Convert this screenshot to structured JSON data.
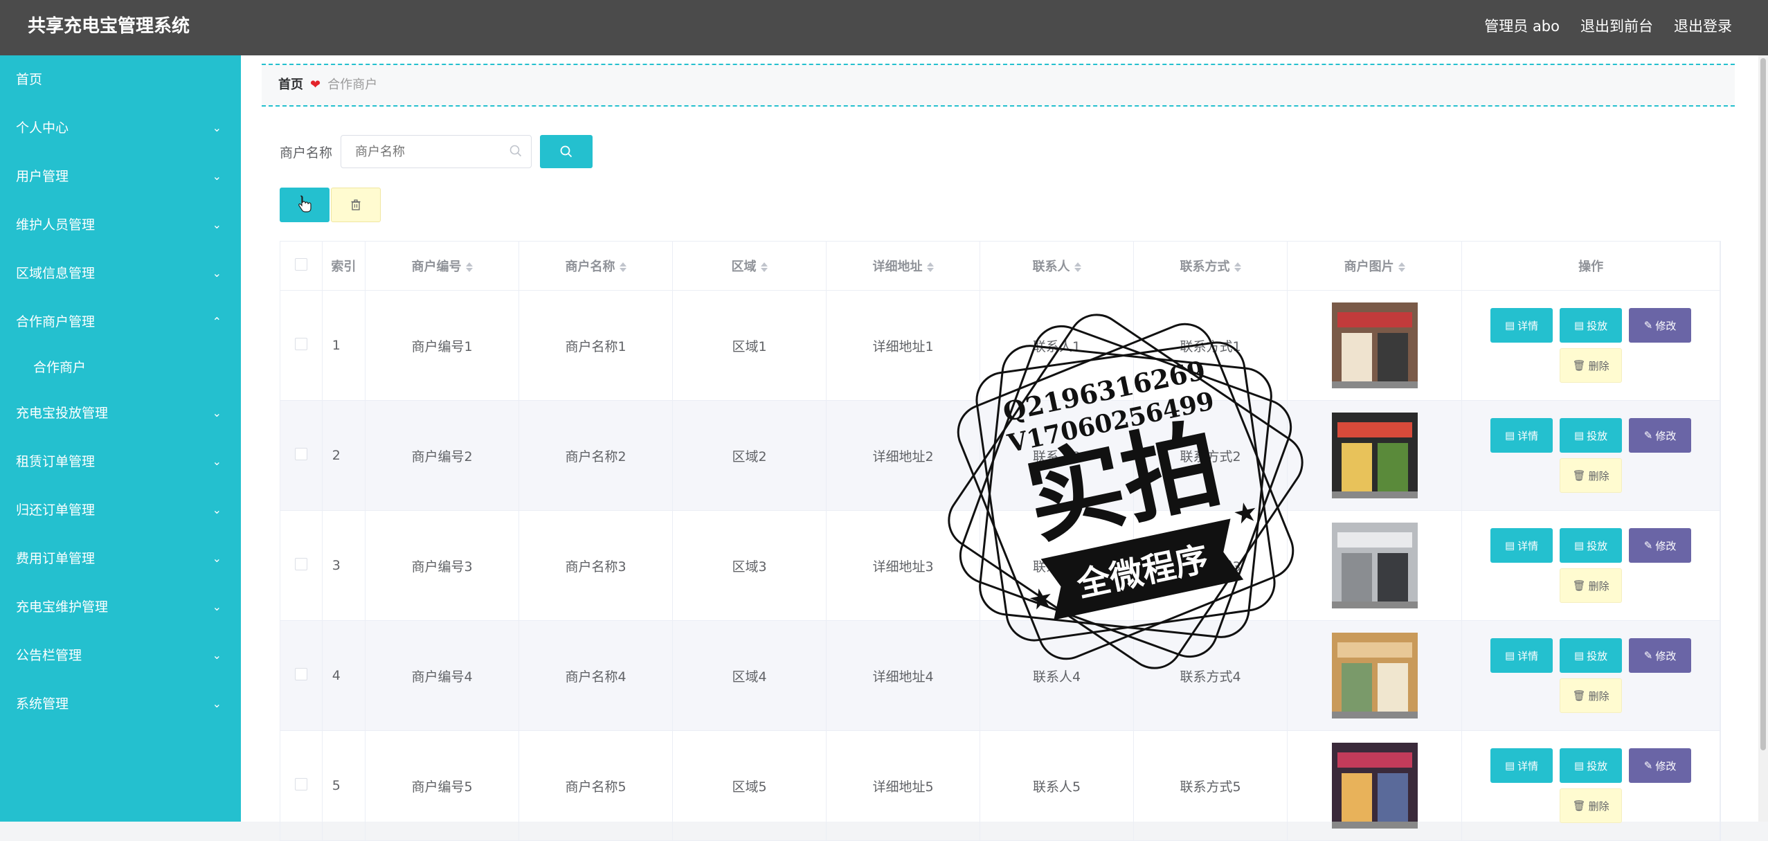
{
  "header": {
    "title": "共享充电宝管理系统",
    "admin": "管理员 abo",
    "to_front": "退出到前台",
    "logout": "退出登录"
  },
  "sidebar": {
    "items": [
      {
        "label": "首页"
      },
      {
        "label": "个人中心"
      },
      {
        "label": "用户管理"
      },
      {
        "label": "维护人员管理"
      },
      {
        "label": "区域信息管理"
      },
      {
        "label": "合作商户管理"
      },
      {
        "label": "合作商户"
      },
      {
        "label": "充电宝投放管理"
      },
      {
        "label": "租赁订单管理"
      },
      {
        "label": "归还订单管理"
      },
      {
        "label": "费用订单管理"
      },
      {
        "label": "充电宝维护管理"
      },
      {
        "label": "公告栏管理"
      },
      {
        "label": "系统管理"
      }
    ]
  },
  "breadcrumb": {
    "home": "首页",
    "current": "合作商户"
  },
  "search": {
    "label": "商户名称",
    "placeholder": "商户名称"
  },
  "table": {
    "headers": {
      "index": "索引",
      "code": "商户编号",
      "name": "商户名称",
      "region": "区域",
      "address": "详细地址",
      "contact": "联系人",
      "phone": "联系方式",
      "image": "商户图片",
      "ops": "操作"
    },
    "rows": [
      {
        "index": "1",
        "code": "商户编号1",
        "name": "商户名称1",
        "region": "区域1",
        "address": "详细地址1",
        "contact": "联系人1",
        "phone": "联系方式1"
      },
      {
        "index": "2",
        "code": "商户编号2",
        "name": "商户名称2",
        "region": "区域2",
        "address": "详细地址2",
        "contact": "联系人2",
        "phone": "联系方式2"
      },
      {
        "index": "3",
        "code": "商户编号3",
        "name": "商户名称3",
        "region": "区域3",
        "address": "详细地址3",
        "contact": "联系人3",
        "phone": "联系方式3"
      },
      {
        "index": "4",
        "code": "商户编号4",
        "name": "商户名称4",
        "region": "区域4",
        "address": "详细地址4",
        "contact": "联系人4",
        "phone": "联系方式4"
      },
      {
        "index": "5",
        "code": "商户编号5",
        "name": "商户名称5",
        "region": "区域5",
        "address": "详细地址5",
        "contact": "联系人5",
        "phone": "联系方式5"
      }
    ],
    "actions": {
      "detail": "详情",
      "deploy": "投放",
      "edit": "修改",
      "delete": "删除"
    }
  },
  "watermark": {
    "line1": "Q2196316269",
    "line2": "V17060256499",
    "main": "实拍",
    "banner": "全微程序"
  },
  "colors": {
    "topbar": "#4b4b4b",
    "sidebar": "#24c0cf",
    "primary": "#24c0cf",
    "edit": "#6a65a6",
    "danger_bg": "#fffbd0"
  }
}
